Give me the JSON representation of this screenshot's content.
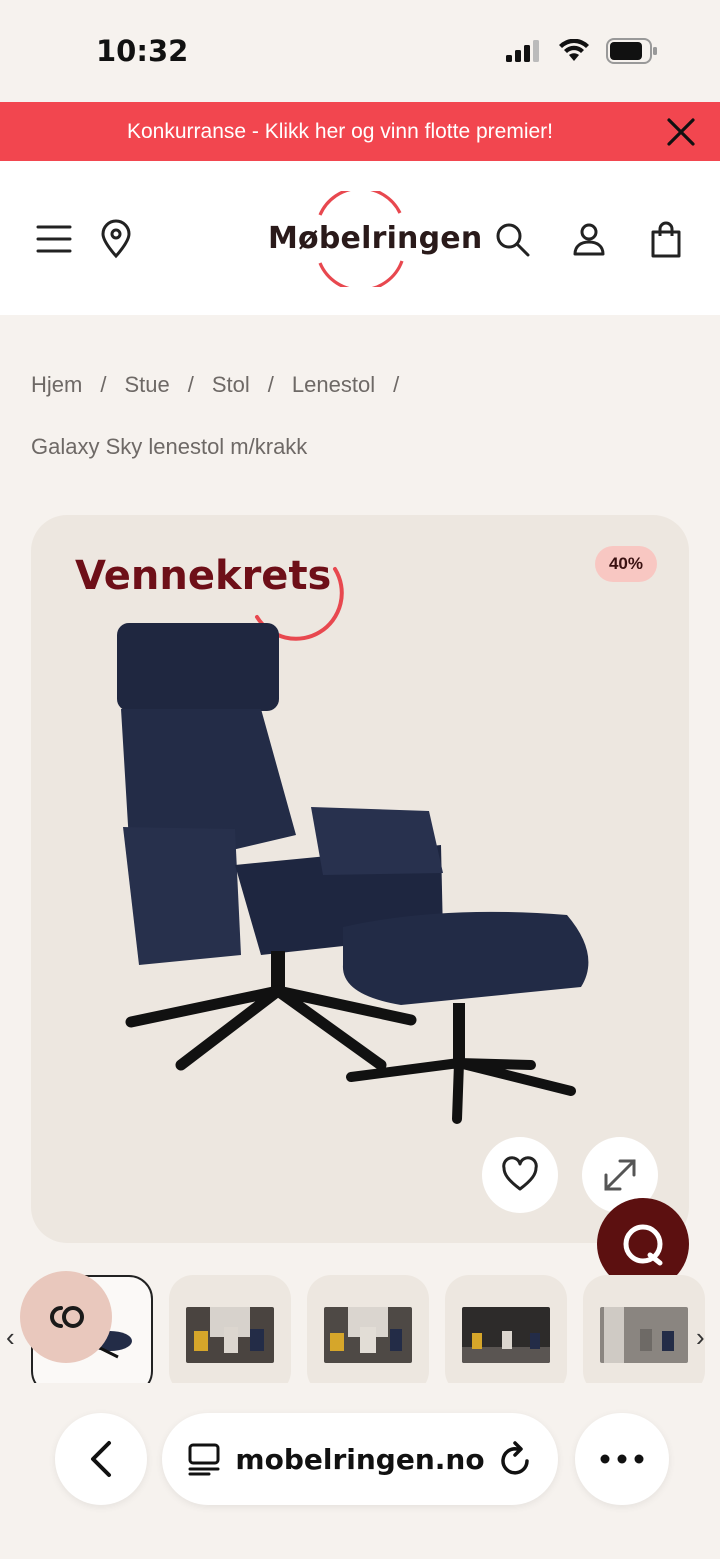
{
  "status": {
    "time": "10:32"
  },
  "promo": {
    "text": "Konkurranse - Klikk her og vinn flotte premier!"
  },
  "header": {
    "logo": "Møbelringen"
  },
  "breadcrumb": {
    "items": [
      "Hjem",
      "Stue",
      "Stol",
      "Lenestol"
    ],
    "separator": "/",
    "current": "Galaxy Sky lenestol m/krakk"
  },
  "product": {
    "badge": "Vennekrets",
    "discount": "40%"
  },
  "browser": {
    "url": "mobelringen.no"
  },
  "colors": {
    "accent": "#f2464f",
    "brand_dark": "#6e0f18",
    "chat": "#5c1010",
    "background": "#f6f2ee"
  }
}
